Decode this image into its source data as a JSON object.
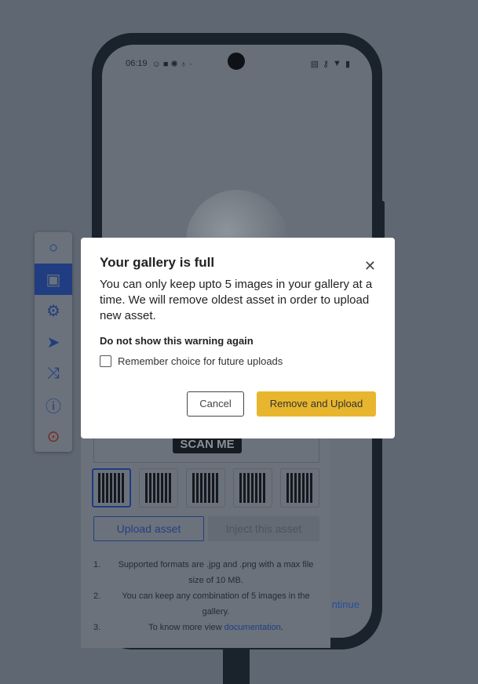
{
  "status_bar": {
    "time": "06:19"
  },
  "app": {
    "continue_label": "ntinue"
  },
  "toolbar": {
    "items": [
      {
        "icon": "circle-icon"
      },
      {
        "icon": "gallery-icon",
        "active": true
      },
      {
        "icon": "gear-icon"
      },
      {
        "icon": "location-arrow-icon"
      },
      {
        "icon": "shuffle-icon"
      },
      {
        "icon": "info-icon"
      },
      {
        "icon": "stop-record-icon"
      }
    ]
  },
  "gallery": {
    "scan_label": "SCAN ME",
    "upload_label": "Upload asset",
    "inject_label": "Inject this asset",
    "notes": [
      {
        "num": "1.",
        "text": "Supported formats are .jpg and .png with a max file size of 10 MB."
      },
      {
        "num": "2.",
        "text": "You can keep any combination of 5 images in the gallery."
      },
      {
        "num": "3.",
        "text": "To know more view ",
        "link": "documentation",
        "end": "."
      }
    ]
  },
  "dialog": {
    "title": "Your gallery is full",
    "message": "You can only keep upto 5 images in your gallery at a time. We will remove oldest asset in order to upload new asset.",
    "subheading": "Do not show this warning again",
    "checkbox_label": "Remember choice for future uploads",
    "checked": false,
    "cancel_label": "Cancel",
    "confirm_label": "Remove and Upload",
    "accent": "#e8b62e"
  }
}
